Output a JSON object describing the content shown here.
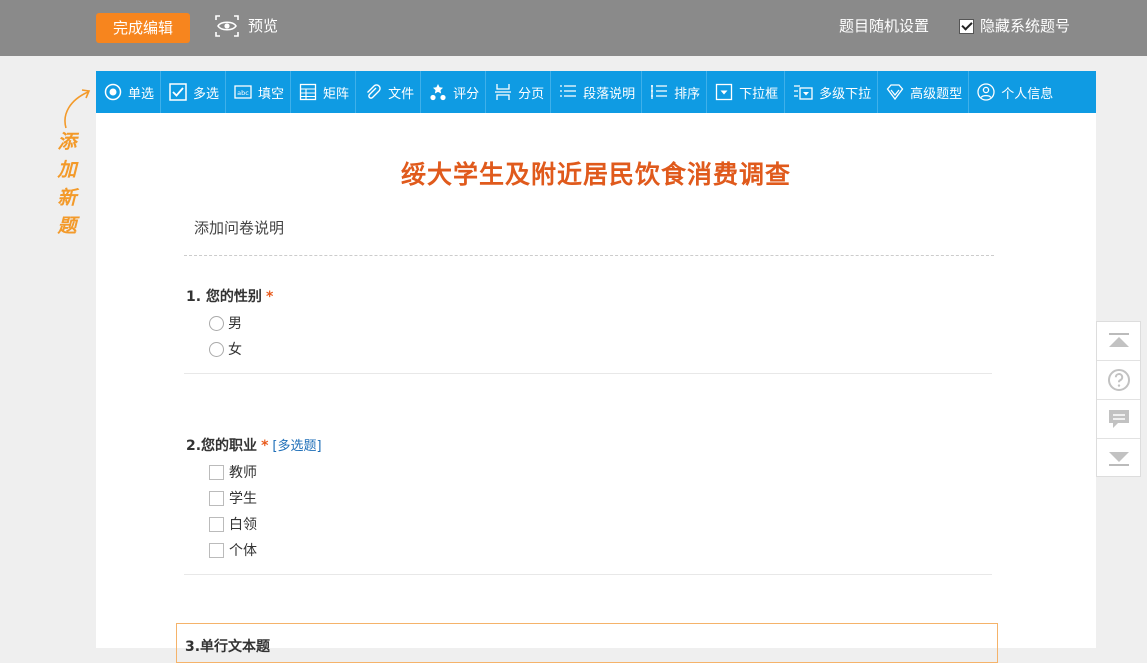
{
  "topbar": {
    "finish_label": "完成编辑",
    "preview_label": "预览",
    "random_label": "题目随机设置",
    "hide_num_label": "隐藏系统题号"
  },
  "side_note": "添加新题",
  "toolbar": {
    "items": [
      {
        "label": "单选",
        "icon": "radio-icon"
      },
      {
        "label": "多选",
        "icon": "checkbox-icon"
      },
      {
        "label": "填空",
        "icon": "abc-icon"
      },
      {
        "label": "矩阵",
        "icon": "matrix-icon"
      },
      {
        "label": "文件",
        "icon": "paperclip-icon"
      },
      {
        "label": "评分",
        "icon": "stars-icon"
      },
      {
        "label": "分页",
        "icon": "page-break-icon"
      },
      {
        "label": "段落说明",
        "icon": "paragraph-icon"
      },
      {
        "label": "排序",
        "icon": "sort-icon"
      },
      {
        "label": "下拉框",
        "icon": "dropdown-icon"
      },
      {
        "label": "多级下拉",
        "icon": "multi-dropdown-icon"
      },
      {
        "label": "高级题型",
        "icon": "diamond-icon"
      },
      {
        "label": "个人信息",
        "icon": "user-icon"
      }
    ]
  },
  "survey": {
    "title": "绥大学生及附近居民饮食消费调查",
    "description": "添加问卷说明",
    "questions": [
      {
        "title": "1. 您的性别",
        "required": "*",
        "options": [
          "男",
          "女"
        ]
      },
      {
        "title": "2.您的职业",
        "required": "*",
        "tag": "[多选题]",
        "options": [
          "教师",
          "学生",
          "白领",
          "个体"
        ]
      },
      {
        "title": "3.单行文本题"
      }
    ]
  },
  "colors": {
    "accent": "#f7851e",
    "toolbar": "#0f9be3",
    "title": "#e05a1c"
  }
}
